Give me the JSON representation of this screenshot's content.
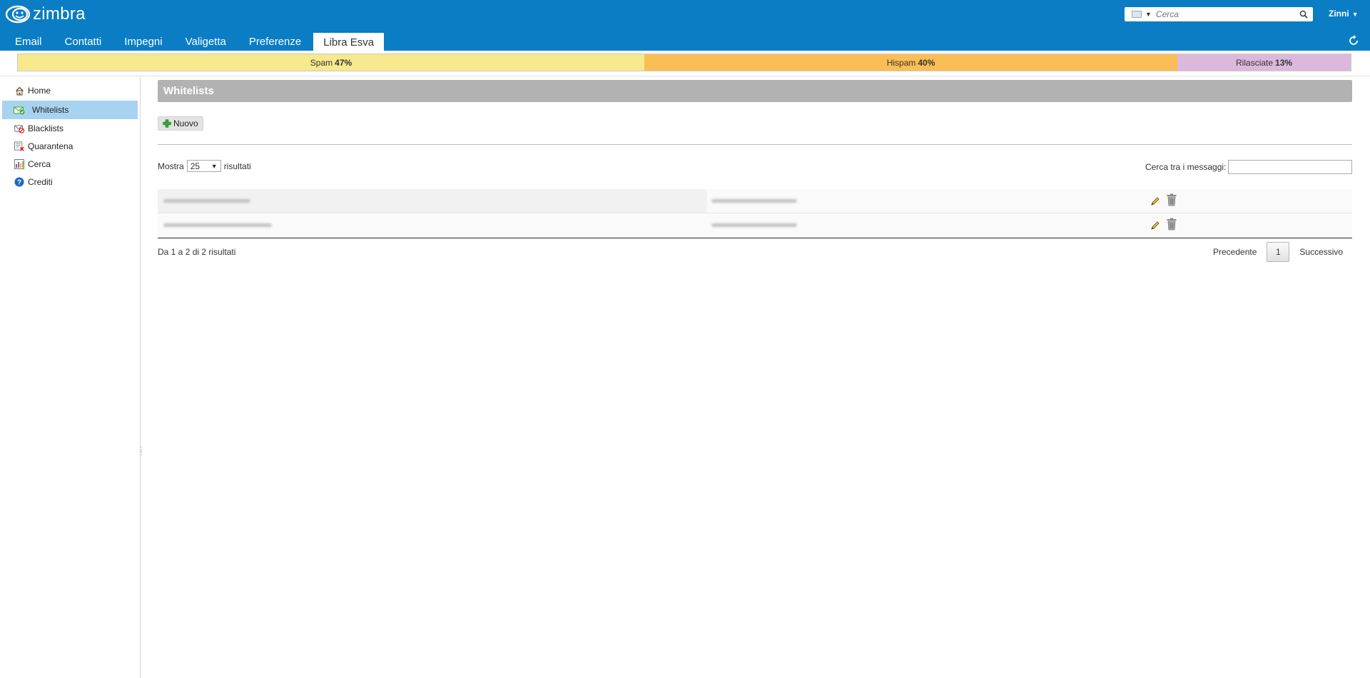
{
  "app": {
    "brand": "zimbra"
  },
  "header": {
    "search_placeholder": "Cerca",
    "user_name": "Zinni",
    "tabs": [
      "Email",
      "Contatti",
      "Impegni",
      "Valigetta",
      "Preferenze",
      "Libra Esva"
    ],
    "active_tab": "Libra Esva"
  },
  "stats": [
    {
      "label": "Spam",
      "value": "47%",
      "percent": 47,
      "color": "#f7e98e"
    },
    {
      "label": "Hispam",
      "value": "40%",
      "percent": 40,
      "color": "#fbbe55"
    },
    {
      "label": "Rilasciate",
      "value": "13%",
      "percent": 13,
      "color": "#dcb9dc"
    }
  ],
  "sidebar": {
    "items": [
      {
        "label": "Home",
        "icon": "home-icon"
      },
      {
        "label": "Whitelists",
        "icon": "whitelist-icon",
        "active": true
      },
      {
        "label": "Blacklists",
        "icon": "blacklist-icon"
      },
      {
        "label": "Quarantena",
        "icon": "quarantine-icon"
      },
      {
        "label": "Cerca",
        "icon": "search-report-icon"
      },
      {
        "label": "Crediti",
        "icon": "help-icon"
      }
    ]
  },
  "main": {
    "title": "Whitelists",
    "new_button": "Nuovo",
    "show_label": "Mostra",
    "page_size": "25",
    "results_label": "risultati",
    "search_label": "Cerca tra i messaggi:",
    "search_value": "",
    "rows": [
      {
        "sender": "",
        "recipient": ""
      },
      {
        "sender": "",
        "recipient": ""
      }
    ],
    "info": "Da 1 a 2 di 2 risultati",
    "pager": {
      "prev": "Precedente",
      "page": "1",
      "next": "Successivo"
    }
  },
  "colors": {
    "header_blue": "#0a7dc5",
    "sidebar_active": "#a7d3f0",
    "title_bar": "#b2b2b2"
  }
}
